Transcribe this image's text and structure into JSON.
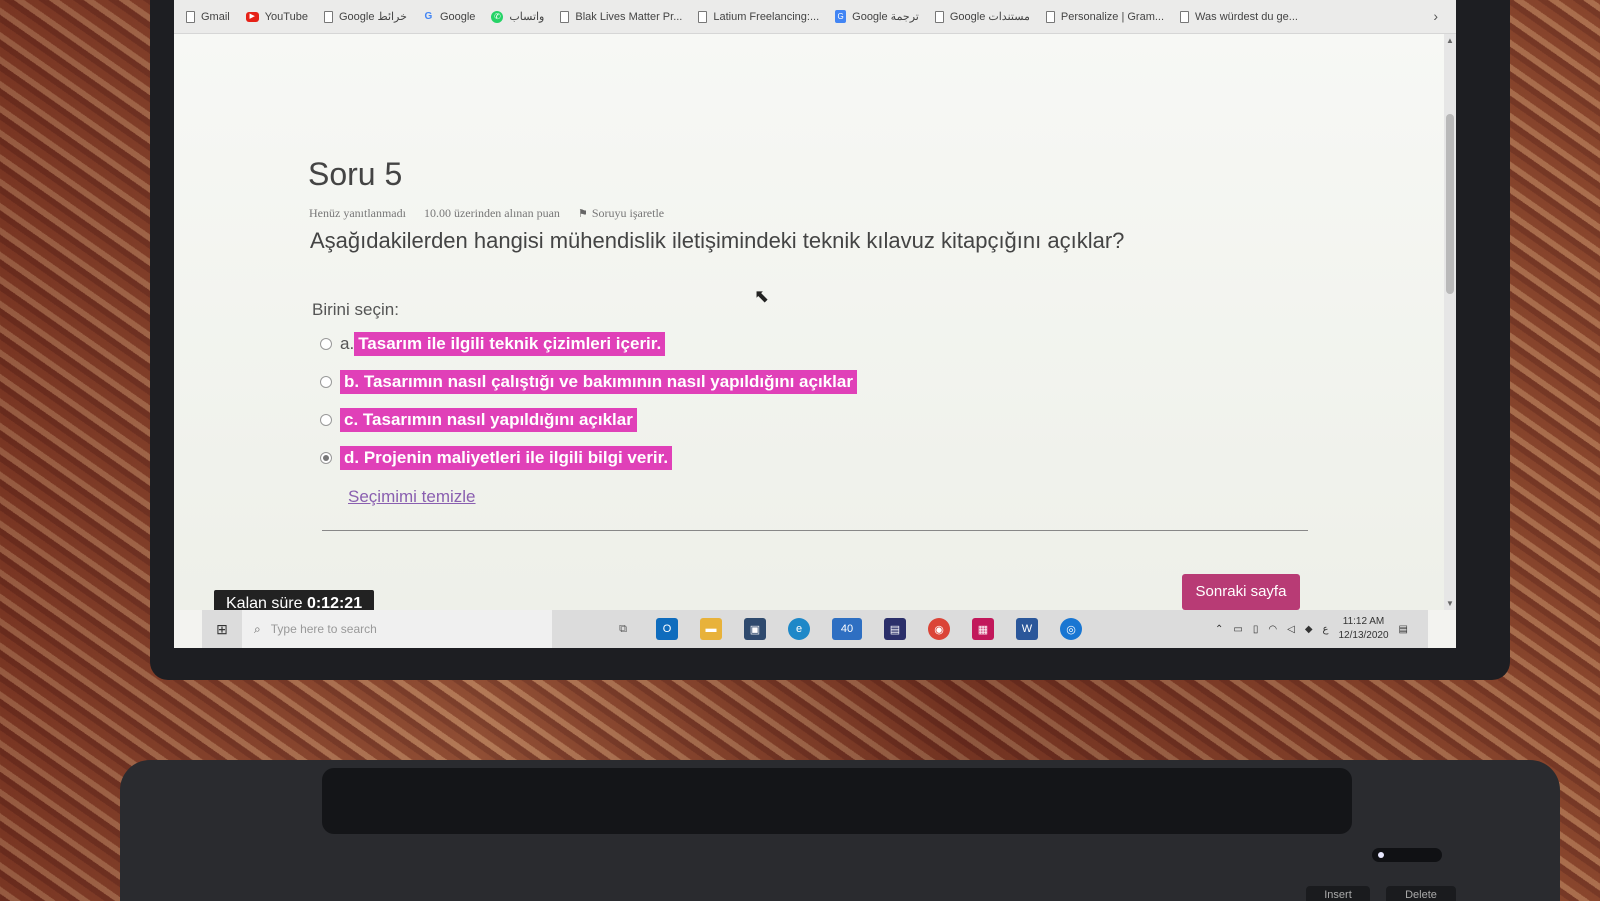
{
  "bookmarks": [
    {
      "label": "Gmail",
      "icon": "document-icon"
    },
    {
      "label": "YouTube",
      "icon": "youtube-icon"
    },
    {
      "label": "Google خرائط",
      "icon": "document-icon"
    },
    {
      "label": "Google",
      "icon": "google-icon"
    },
    {
      "label": "واتساب",
      "icon": "whatsapp-icon"
    },
    {
      "label": "Blak Lives Matter Pr...",
      "icon": "document-icon"
    },
    {
      "label": "Latium Freelancing:...",
      "icon": "document-icon"
    },
    {
      "label": "Google ترجمة",
      "icon": "translate-icon"
    },
    {
      "label": "Google مستندات",
      "icon": "document-icon"
    },
    {
      "label": "Personalize | Gram...",
      "icon": "document-icon"
    },
    {
      "label": "Was würdest du ge...",
      "icon": "document-icon"
    }
  ],
  "question": {
    "title": "Soru 5",
    "status": "Henüz yanıtlanmadı",
    "points": "10.00 üzerinden alınan puan",
    "flag_label": "Soruyu işaretle",
    "text": "Aşağıdakilerden hangisi mühendislik iletişimindeki teknik kılavuz kitapçığını açıklar?",
    "choose_label": "Birini seçin:",
    "options": [
      {
        "letter": "a.",
        "text": "Tasarım ile ilgili teknik çizimleri içerir.",
        "checked": false
      },
      {
        "letter": "b.",
        "text": "Tasarımın nasıl çalıştığı ve bakımının nasıl yapıldığını açıklar",
        "checked": false
      },
      {
        "letter": "c.",
        "text": "Tasarımın nasıl yapıldığını açıklar",
        "checked": false
      },
      {
        "letter": "d.",
        "text": "Projenin maliyetleri ile ilgili bilgi verir.",
        "checked": true
      }
    ],
    "clear_label": "Seçimimi temizle"
  },
  "next_button": "Sonraki sayfa",
  "timer": {
    "label": "Kalan süre",
    "value": "0:12:21"
  },
  "taskbar": {
    "search_placeholder": "Type here to search",
    "mail_badge": "40",
    "time": "11:12 AM",
    "date": "12/13/2020",
    "lang": "ع"
  },
  "keyboard": {
    "insert": "Insert",
    "delete": "Delete"
  },
  "colors": {
    "highlight": "#e040b8",
    "next_button": "#b83b75",
    "link": "#8a5fb0"
  }
}
